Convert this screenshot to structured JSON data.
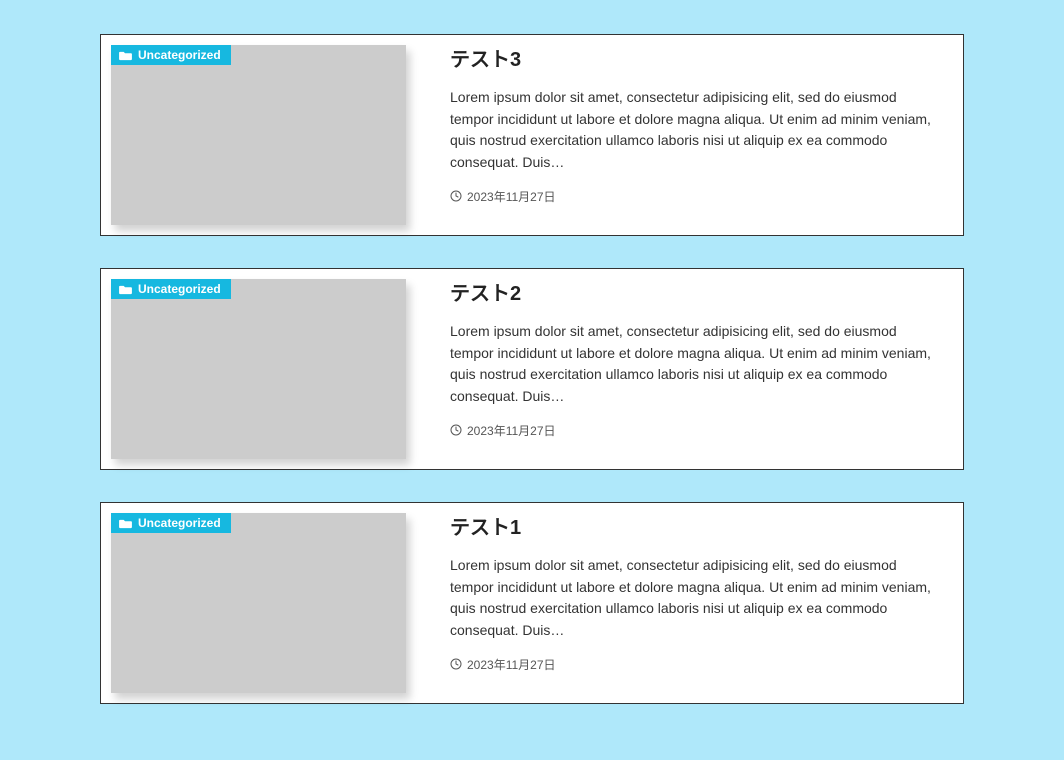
{
  "posts": [
    {
      "category": "Uncategorized",
      "title": "テスト3",
      "excerpt": "Lorem ipsum dolor sit amet, consectetur adipisicing elit, sed do eiusmod tempor incididunt ut labore et dolore magna aliqua. Ut enim ad minim veniam, quis nostrud exercitation ullamco laboris nisi ut aliquip ex ea commodo consequat. Duis…",
      "date": "2023年11月27日"
    },
    {
      "category": "Uncategorized",
      "title": "テスト2",
      "excerpt": "Lorem ipsum dolor sit amet, consectetur adipisicing elit, sed do eiusmod tempor incididunt ut labore et dolore magna aliqua. Ut enim ad minim veniam, quis nostrud exercitation ullamco laboris nisi ut aliquip ex ea commodo consequat. Duis…",
      "date": "2023年11月27日"
    },
    {
      "category": "Uncategorized",
      "title": "テスト1",
      "excerpt": "Lorem ipsum dolor sit amet, consectetur adipisicing elit, sed do eiusmod tempor incididunt ut labore et dolore magna aliqua. Ut enim ad minim veniam, quis nostrud exercitation ullamco laboris nisi ut aliquip ex ea commodo consequat. Duis…",
      "date": "2023年11月27日"
    }
  ]
}
